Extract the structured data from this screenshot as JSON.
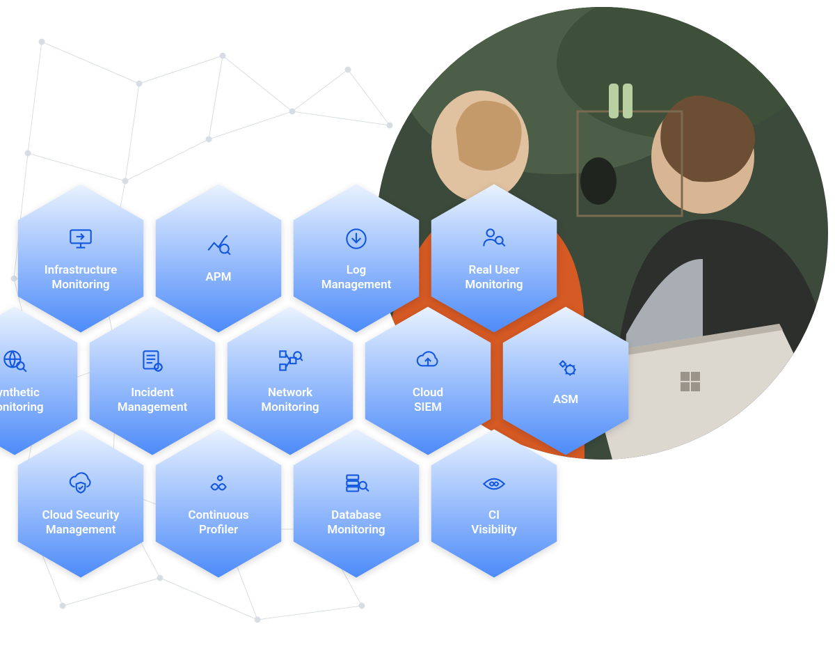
{
  "colors": {
    "hex_gradient_top": "#e9f2ff",
    "hex_gradient_bottom": "#4d8bf9",
    "icon_color": "#1257dd",
    "label_color": "#ffffff"
  },
  "rows": [
    [
      {
        "icon": "monitor-arrow",
        "label": "Infrastructure\nMonitoring"
      },
      {
        "icon": "chart-magnify",
        "label": "APM"
      },
      {
        "icon": "download-circle",
        "label": "Log\nManagement"
      },
      {
        "icon": "user-magnify",
        "label": "Real User\nMonitoring"
      }
    ],
    [
      {
        "icon": "globe-magnify",
        "label": "Synthetic\nMonitoring"
      },
      {
        "icon": "clipboard-gear",
        "label": "Incident\nManagement"
      },
      {
        "icon": "nodes-magnify",
        "label": "Network\nMonitoring"
      },
      {
        "icon": "cloud-up",
        "label": "Cloud\nSIEM"
      },
      {
        "icon": "gear-diamond",
        "label": "ASM"
      }
    ],
    [
      {
        "icon": "cloud-shield",
        "label": "Cloud Security\nManagement"
      },
      {
        "icon": "infinity-gear",
        "label": "Continuous\nProfiler"
      },
      {
        "icon": "db-magnify",
        "label": "Database\nMonitoring"
      },
      {
        "icon": "eye-infinity",
        "label": "CI\nVisibility"
      }
    ]
  ]
}
